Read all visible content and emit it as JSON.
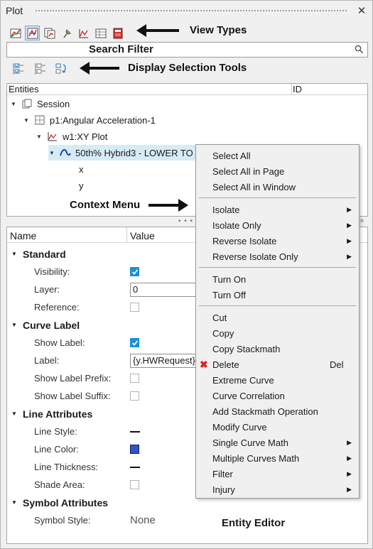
{
  "panel": {
    "title": "Plot",
    "close": "✕"
  },
  "view_types": {
    "callout": "View Types",
    "buttons": [
      "plot-icon",
      "xy-plot-icon",
      "pages-icon",
      "pin-icon",
      "chart-icon",
      "table-icon",
      "book-icon"
    ]
  },
  "search": {
    "label": "Search Filter",
    "placeholder": ""
  },
  "display_tools": {
    "callout": "Display Selection Tools",
    "buttons": [
      "select-all-icon",
      "select-none-icon",
      "reverse-selection-icon"
    ]
  },
  "tree": {
    "columns": [
      "Entities",
      "ID"
    ],
    "nodes": [
      {
        "label": "Session"
      },
      {
        "label": "p1:Angular Acceleration-1"
      },
      {
        "label": "w1:XY Plot"
      },
      {
        "label": "50th% Hybrid3   - LOWER TO"
      },
      {
        "label": "x"
      },
      {
        "label": "y"
      }
    ]
  },
  "context_callout": "Context Menu",
  "editor": {
    "columns": [
      "Name",
      "Value"
    ],
    "title": "Entity Editor",
    "groups": {
      "standard": "Standard",
      "curve_label": "Curve Label",
      "line_attributes": "Line Attributes",
      "symbol_attributes": "Symbol Attributes"
    },
    "props": {
      "visibility": {
        "label": "Visibility:",
        "checked": true
      },
      "layer": {
        "label": "Layer:",
        "value": "0"
      },
      "reference": {
        "label": "Reference:",
        "checked": false
      },
      "show_label": {
        "label": "Show Label:",
        "checked": true
      },
      "label": {
        "label": "Label:",
        "value": "{y.HWRequest}"
      },
      "show_label_prefix": {
        "label": "Show Label Prefix:",
        "checked": false
      },
      "show_label_suffix": {
        "label": "Show Label Suffix:",
        "checked": false
      },
      "line_style": {
        "label": "Line Style:"
      },
      "line_color": {
        "label": "Line Color:",
        "color": "#2f56c6"
      },
      "line_thickness": {
        "label": "Line Thickness:"
      },
      "shade_area": {
        "label": "Shade Area:",
        "checked": false
      },
      "symbol_style": {
        "label": "Symbol Style:",
        "value": "None"
      }
    }
  },
  "context_menu": {
    "items": [
      "Select All",
      "Select All in Page",
      "Select All in Window",
      "Isolate",
      "Isolate Only",
      "Reverse Isolate",
      "Reverse Isolate Only",
      "Turn On",
      "Turn Off",
      "Cut",
      "Copy",
      "Copy Stackmath",
      "Delete",
      "Extreme Curve",
      "Curve Correlation",
      "Add Stackmath Operation",
      "Modify Curve",
      "Single Curve Math",
      "Multiple Curves Math",
      "Filter",
      "Injury"
    ],
    "delete_shortcut": "Del"
  },
  "colors": {
    "selection": "#d7ebf7",
    "checkbox": "#1a8fd8",
    "delete": "#dd2222"
  }
}
